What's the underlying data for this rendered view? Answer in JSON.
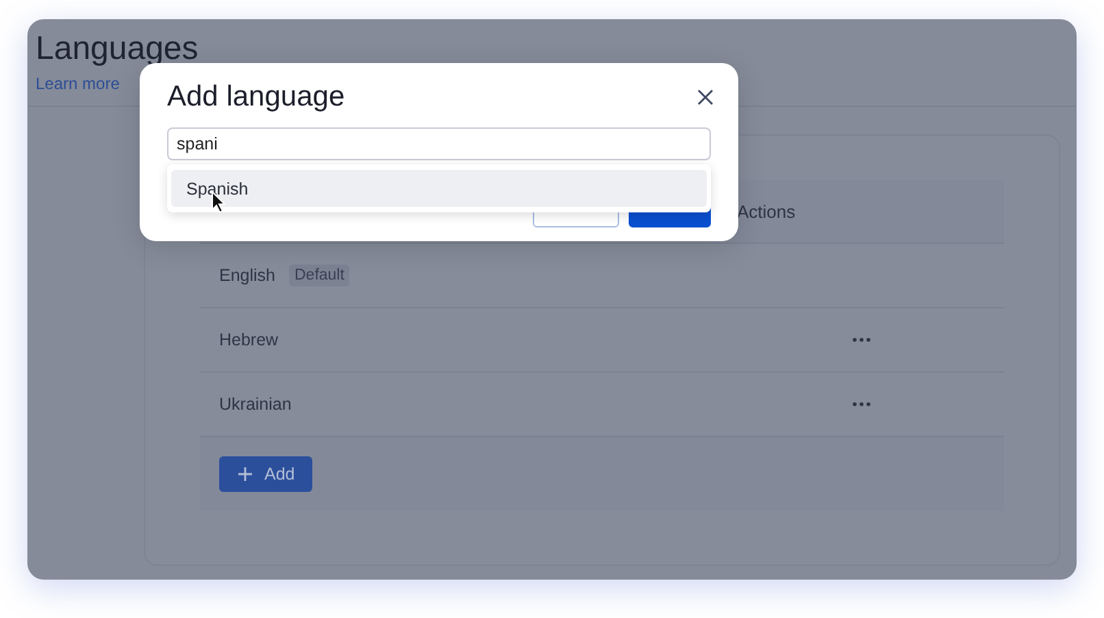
{
  "page": {
    "title": "Languages",
    "link": "Learn more"
  },
  "table": {
    "columns": [
      "Actions"
    ],
    "rows": [
      {
        "name": "English",
        "badge": "Default",
        "menu": false
      },
      {
        "name": "Hebrew",
        "menu": true
      },
      {
        "name": "Ukrainian",
        "menu": true
      }
    ],
    "add_button": "Add"
  },
  "dialog": {
    "title": "Add language",
    "search": {
      "value": "spani"
    },
    "suggestions": [
      {
        "label": "Spanish",
        "selected": true
      }
    ],
    "buttons": [
      {
        "kind": "secondary"
      },
      {
        "kind": "primary"
      }
    ]
  }
}
